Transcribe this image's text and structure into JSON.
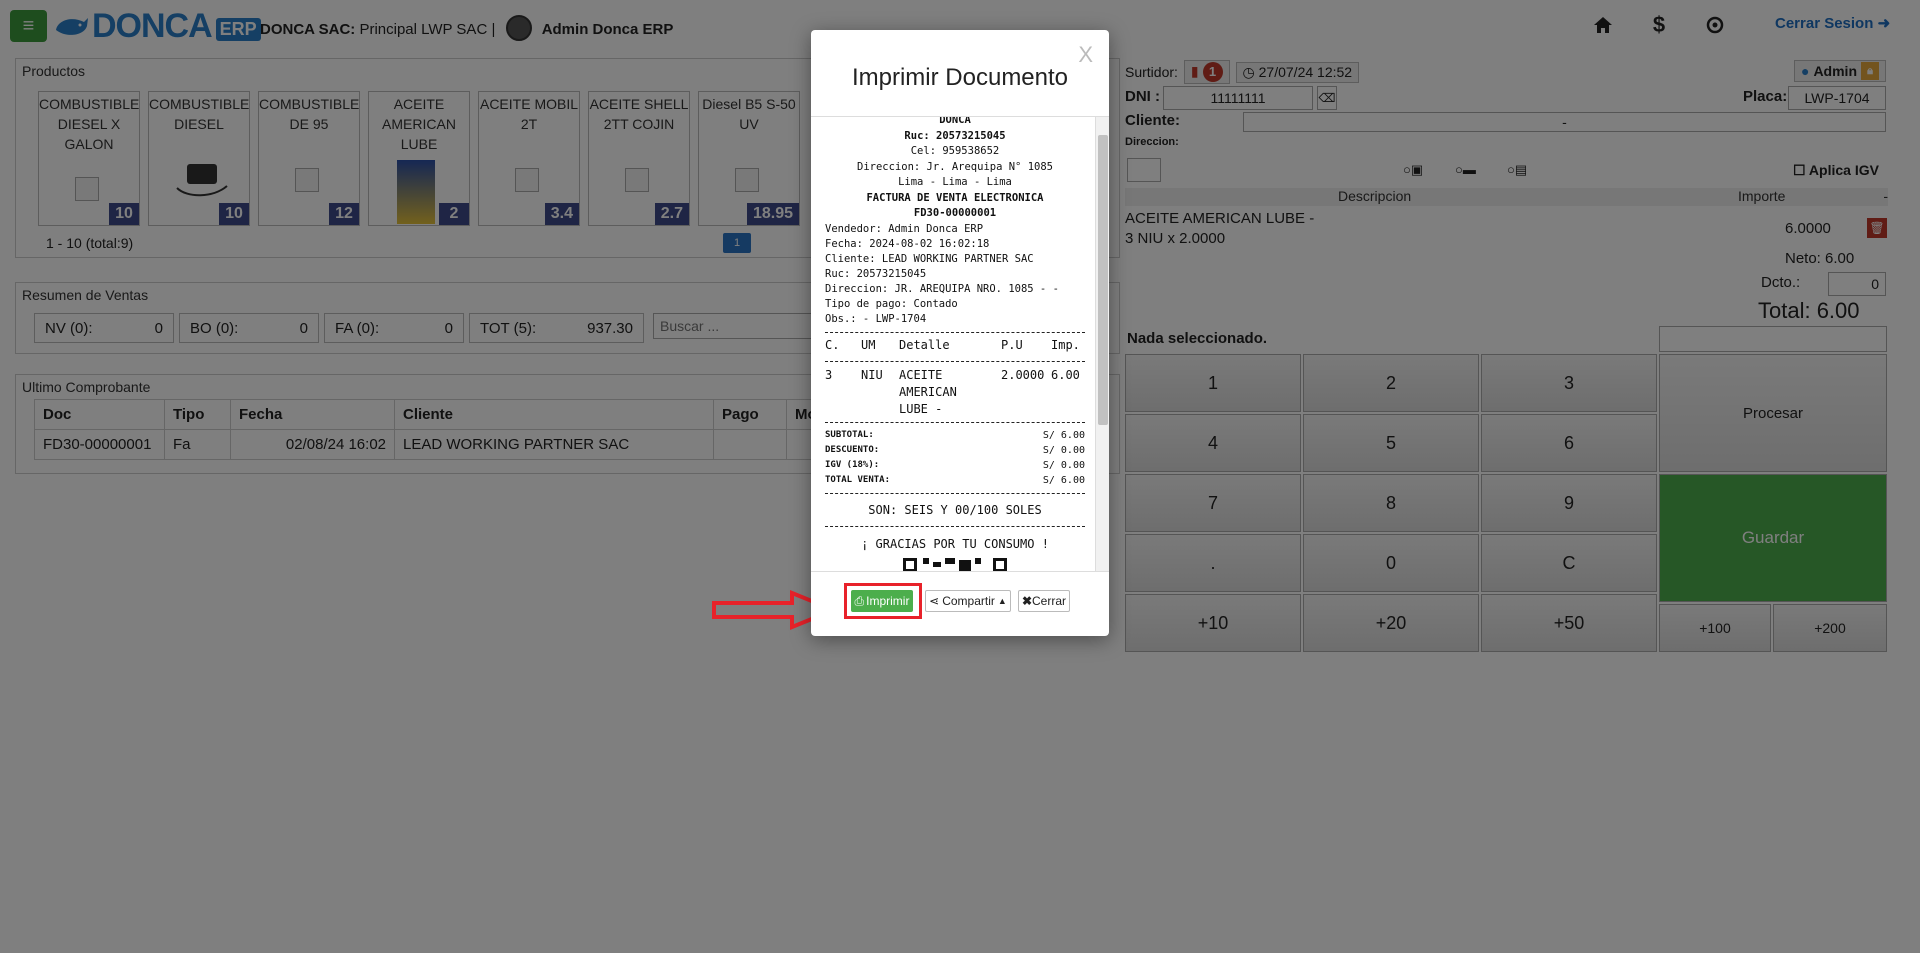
{
  "header": {
    "logo_text": "DONCA",
    "logo_badge": "ERP",
    "company_prefix": "DONCA SAC:",
    "company_branch": " Principal LWP SAC |",
    "user_name": "Admin Donca ERP",
    "logout_label": "Cerrar Sesion"
  },
  "products": {
    "title": "Productos",
    "items": [
      {
        "name": "COMBUSTIBLE DIESEL X GALON",
        "stock": "10"
      },
      {
        "name": "COMBUSTIBLE DIESEL",
        "stock": "10"
      },
      {
        "name": "COMBUSTIBLE DE 95",
        "stock": "12"
      },
      {
        "name": "ACEITE AMERICAN LUBE",
        "stock": "2"
      },
      {
        "name": "ACEITE MOBIL 2T",
        "stock": "3.4"
      },
      {
        "name": "ACEITE SHELL 2TT COJIN",
        "stock": "2.7"
      },
      {
        "name": "Diesel B5 S-50 UV",
        "stock": "18.95"
      }
    ],
    "pager_text": "1 - 10 (total:9)",
    "page": "1"
  },
  "resumen": {
    "title": "Resumen de Ventas",
    "boxes": [
      {
        "label": "NV (0):",
        "value": "0"
      },
      {
        "label": "BO (0):",
        "value": "0"
      },
      {
        "label": "FA (0):",
        "value": "0"
      },
      {
        "label": "TOT (5):",
        "value": "937.30"
      }
    ],
    "search_placeholder": "Buscar ..."
  },
  "ultimo": {
    "title": "Ultimo Comprobante",
    "headers": [
      "Doc",
      "Tipo",
      "Fecha",
      "Cliente",
      "Pago",
      "Mo"
    ],
    "row": [
      "FD30-00000001",
      "Fa",
      "02/08/24 16:02",
      "LEAD WORKING PARTNER SAC",
      "",
      ""
    ]
  },
  "venta": {
    "surtidor_label": "Surtidor:",
    "surtidor_count": "1",
    "datetime": "27/07/24 12:52",
    "admin_label": "Admin",
    "dni_label": "DNI :",
    "dni_value": "11111111",
    "placa_label": "Placa:",
    "placa_value": "LWP-1704",
    "cliente_label": "Cliente:",
    "cliente_value": "-",
    "direccion_label": "Direccion:",
    "igv_label": "Aplica IGV",
    "col_desc": "Descripcion",
    "col_importe": "Importe",
    "col_dash": "-",
    "item_line1": "ACEITE AMERICAN LUBE -",
    "item_line2": "3 NIU x 2.0000",
    "item_amount": "6.0000",
    "neto": "Neto: 6.00",
    "dcto_label": "Dcto.:",
    "dcto_value": "0",
    "total": "Total: 6.00",
    "nada": "Nada seleccionado.",
    "keys": [
      "1",
      "2",
      "3",
      "4",
      "5",
      "6",
      "7",
      "8",
      "9",
      ".",
      "0",
      "C",
      "+10",
      "+20",
      "+50",
      "+100",
      "+200"
    ],
    "procesar": "Procesar",
    "guardar": "Guardar"
  },
  "modal": {
    "close_x": "X",
    "title": "Imprimir Documento",
    "receipt": {
      "business": "DONCA",
      "ruc": "Ruc: 20573215045",
      "cel": "Cel: 959538652",
      "direccion": "Direccion: Jr. Arequipa N° 1085",
      "ciudad": "Lima - Lima - Lima",
      "doc_type": "FACTURA DE VENTA ELECTRONICA",
      "doc_number": "FD30-00000001",
      "vendedor": "Vendedor: Admin Donca ERP",
      "fecha": "Fecha: 2024-08-02 16:02:18",
      "cliente": "Cliente: LEAD WORKING PARTNER SAC",
      "cliente_ruc": "Ruc: 20573215045",
      "cliente_dir": "Direccion: JR. AREQUIPA NRO. 1085 - -",
      "tipo_pago": "Tipo de pago: Contado",
      "obs": "Obs.: - LWP-1704",
      "col_c": "C.",
      "col_um": "UM",
      "col_detalle": "Detalle",
      "col_pu": "P.U",
      "col_imp": "Imp.",
      "item_c": "3",
      "item_um": "NIU",
      "item_detalle": "ACEITE AMERICAN LUBE -",
      "item_pu": "2.0000",
      "item_imp": "6.00",
      "subtotal_label": "SUBTOTAL:",
      "subtotal": "S/ 6.00",
      "descuento_label": "DESCUENTO:",
      "descuento": "S/ 0.00",
      "igv_label": "IGV (18%):",
      "igv": "S/ 0.00",
      "total_label": "TOTAL VENTA:",
      "total": "S/ 6.00",
      "son": "SON: SEIS Y 00/100 SOLES",
      "gracias": "¡ GRACIAS POR TU CONSUMO !"
    },
    "print_label": "Imprimir",
    "share_label": "Compartir",
    "close_label": "Cerrar"
  },
  "colors": {
    "accent_blue": "#2a7fc8",
    "green": "#4cae4c",
    "highlight_red": "#e8222a",
    "stock_badge": "#3e4a8a"
  }
}
